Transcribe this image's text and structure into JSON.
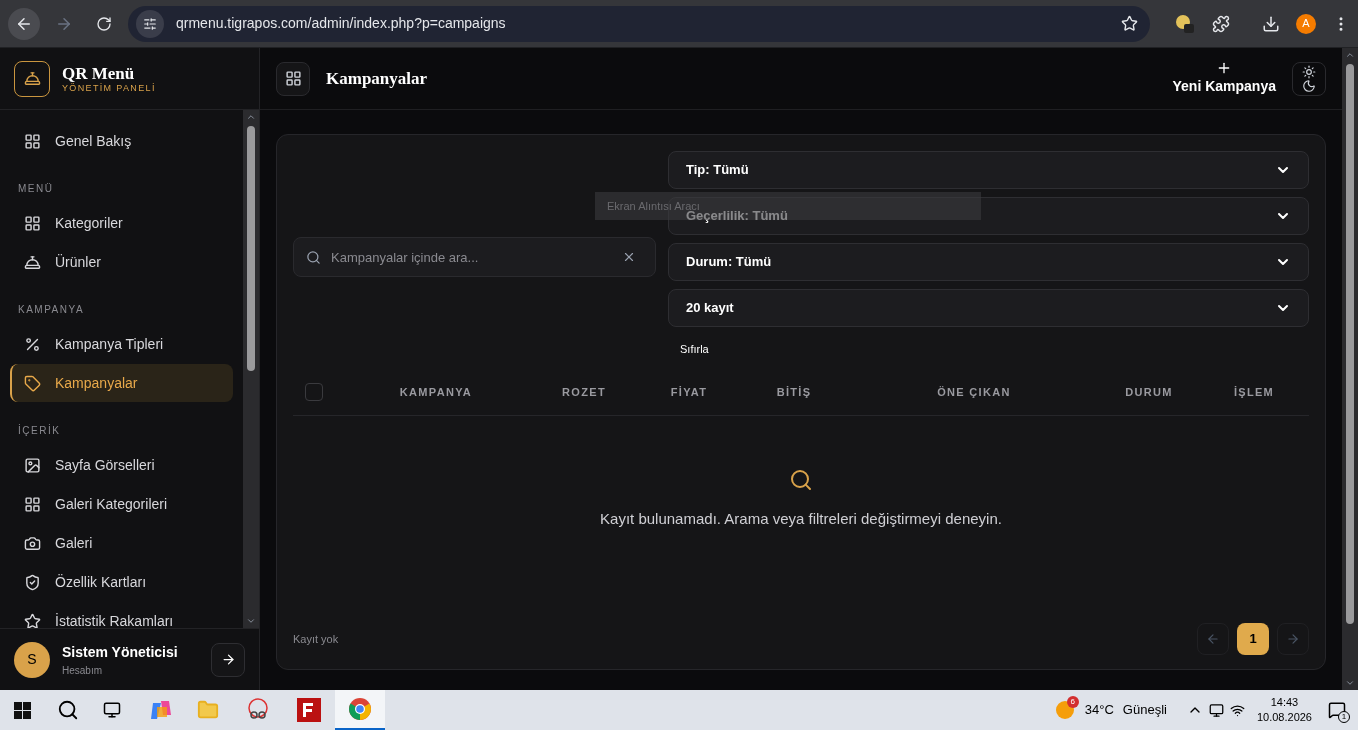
{
  "browser": {
    "url": "qrmenu.tigrapos.com/admin/index.php?p=campaigns",
    "profile_initial": "A"
  },
  "sidebar": {
    "logo_title": "QR Menü",
    "logo_subtitle": "YÖNETİM PANELİ",
    "sections": [
      {
        "items": [
          {
            "label": "Genel Bakış",
            "kind": "grid",
            "selected": false
          }
        ]
      },
      {
        "heading": "MENÜ",
        "items": [
          {
            "label": "Kategoriler",
            "kind": "grid",
            "selected": false
          },
          {
            "label": "Ürünler",
            "kind": "bell",
            "selected": false
          }
        ]
      },
      {
        "heading": "KAMPANYA",
        "items": [
          {
            "label": "Kampanya Tipleri",
            "kind": "percent",
            "selected": false
          },
          {
            "label": "Kampanyalar",
            "kind": "tag",
            "selected": true
          }
        ]
      },
      {
        "heading": "İÇERİK",
        "items": [
          {
            "label": "Sayfa Görselleri",
            "kind": "image",
            "selected": false
          },
          {
            "label": "Galeri Kategorileri",
            "kind": "grid",
            "selected": false
          },
          {
            "label": "Galeri",
            "kind": "camera",
            "selected": false
          },
          {
            "label": "Özellik Kartları",
            "kind": "shield",
            "selected": false
          },
          {
            "label": "İstatistik Rakamları",
            "kind": "star",
            "selected": false
          }
        ]
      }
    ],
    "user": {
      "initial": "S",
      "name": "Sistem Yöneticisi",
      "subtitle": "Hesabım"
    }
  },
  "header": {
    "title": "Kampanyalar",
    "new_button": "Yeni Kampanya"
  },
  "filters": {
    "search_placeholder": "Kampanyalar içinde ara...",
    "selects": [
      "Tip: Tümü",
      "Geçerlilik: Tümü",
      "Durum: Tümü",
      "20 kayıt"
    ],
    "reset": "Sıfırla"
  },
  "tooltip": "Ekran Alıntısı Aracı",
  "table": {
    "select_all_checked": false,
    "columns": [
      "KAMPANYA",
      "ROZET",
      "FİYAT",
      "BİTİŞ",
      "ÖNE ÇIKAN",
      "DURUM",
      "İŞLEM"
    ],
    "empty_message": "Kayıt bulunamadı. Arama veya filtreleri değiştirmeyi deneyin."
  },
  "footer": {
    "count_text": "Kayıt yok",
    "pages": [
      {
        "label": "1",
        "selected": true
      }
    ]
  },
  "taskbar": {
    "weather_badge": "6",
    "temperature": "34°C",
    "weather": "Güneşli",
    "time": "14:43",
    "date": "10.08.2026",
    "notification_count": "1"
  }
}
